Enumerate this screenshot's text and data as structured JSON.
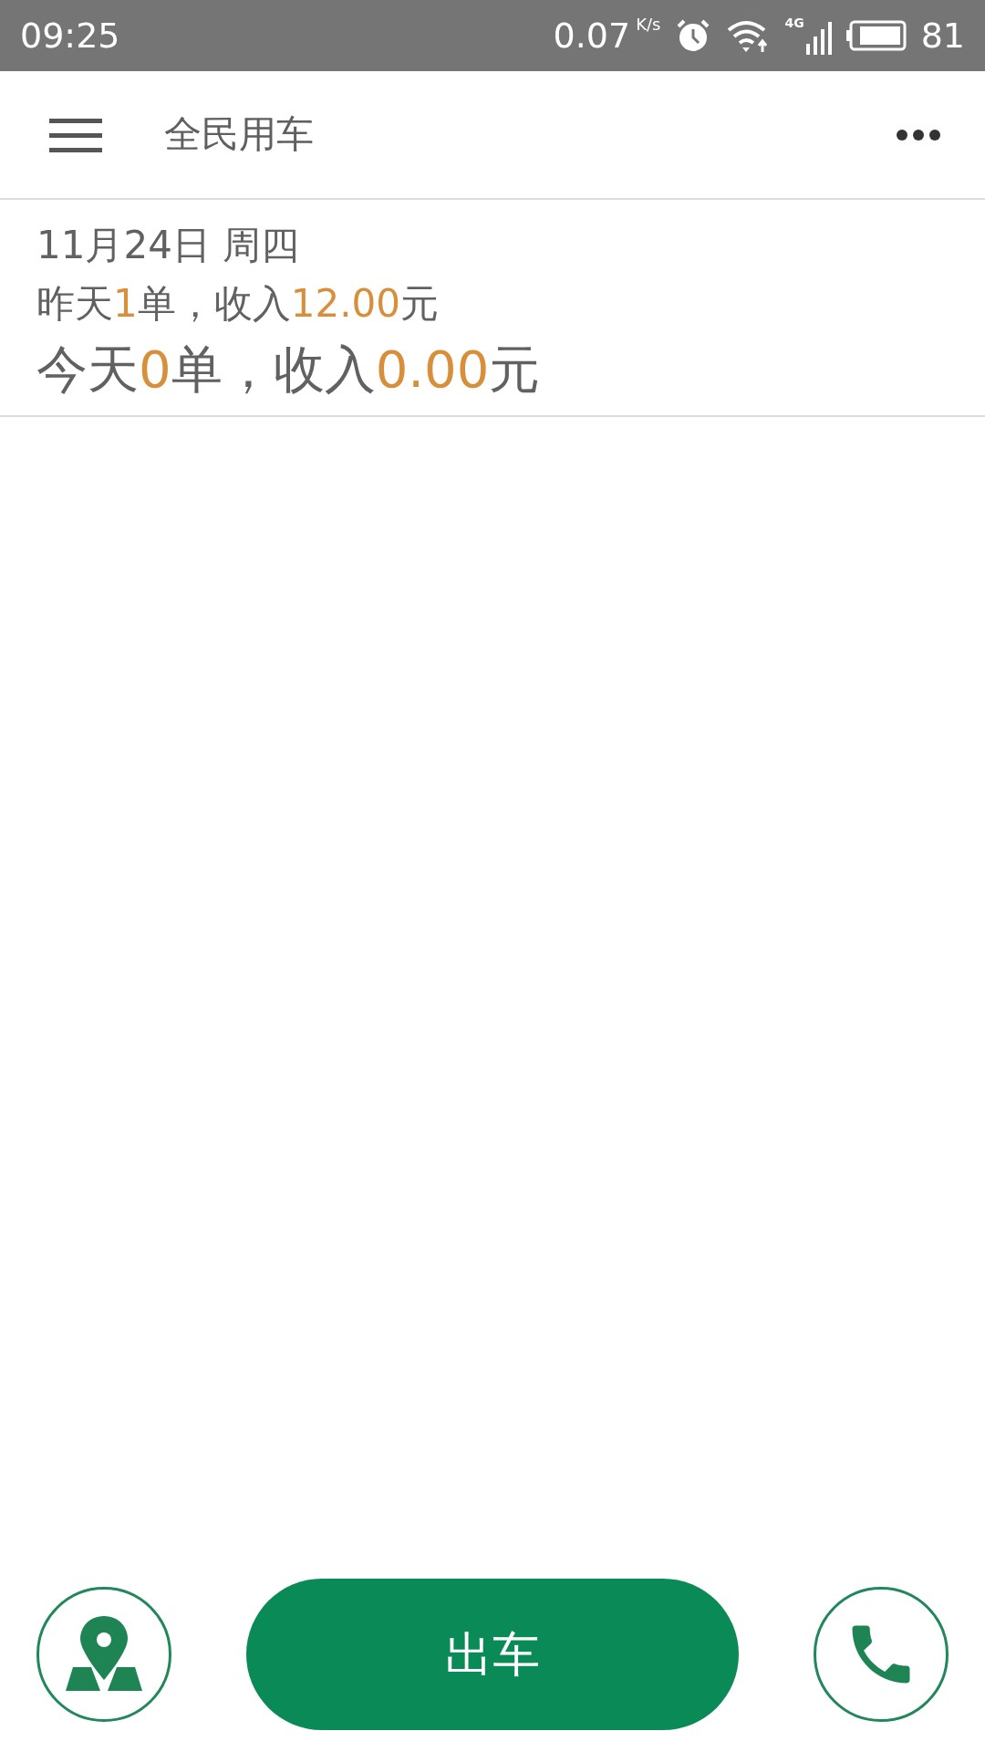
{
  "status_bar": {
    "time": "09:25",
    "speed": "0.07",
    "speed_unit": "K/s",
    "network": "4G",
    "battery": "81"
  },
  "app_bar": {
    "title": "全民用车"
  },
  "summary": {
    "date": "11月24日 周四",
    "yesterday": [
      {
        "text": "昨天",
        "highlight": false
      },
      {
        "text": "1",
        "highlight": true
      },
      {
        "text": "单，收入",
        "highlight": false
      },
      {
        "text": "12.00",
        "highlight": true
      },
      {
        "text": "元",
        "highlight": false
      }
    ],
    "today": [
      {
        "text": "今天",
        "highlight": false
      },
      {
        "text": "0",
        "highlight": true
      },
      {
        "text": "单，收入",
        "highlight": false
      },
      {
        "text": "0.00",
        "highlight": true
      },
      {
        "text": "元",
        "highlight": false
      }
    ]
  },
  "bottom": {
    "main_button": "出车"
  }
}
